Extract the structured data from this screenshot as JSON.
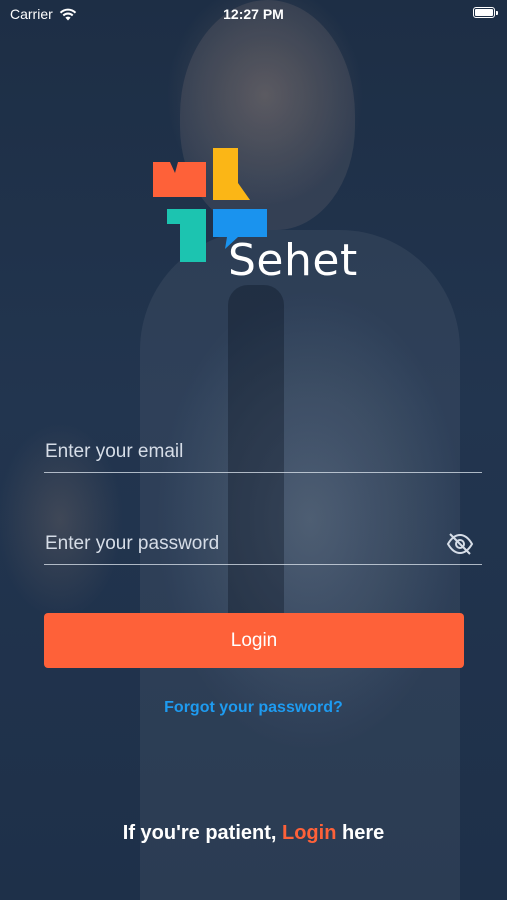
{
  "status_bar": {
    "carrier": "Carrier",
    "time": "12:27 PM",
    "wifi_icon": "wifi-icon",
    "battery_icon": "battery-icon"
  },
  "brand": {
    "name": "Sehet",
    "logo_colors": {
      "red": "#fe6139",
      "yellow": "#fbb616",
      "teal": "#1cc4b0",
      "blue": "#1a93ee"
    }
  },
  "login_form": {
    "email_placeholder": "Enter your email",
    "email_value": "",
    "password_placeholder": "Enter your password",
    "password_value": "",
    "password_toggle_icon": "eye-slash-icon",
    "login_label": "Login",
    "forgot_label": "Forgot your password?"
  },
  "patient_prompt": {
    "prefix": "If you're patient, ",
    "link_label": "Login",
    "suffix": " here"
  },
  "colors": {
    "accent": "#fe6139",
    "link": "#1e9bf0",
    "background_overlay": "#1c2d44"
  }
}
